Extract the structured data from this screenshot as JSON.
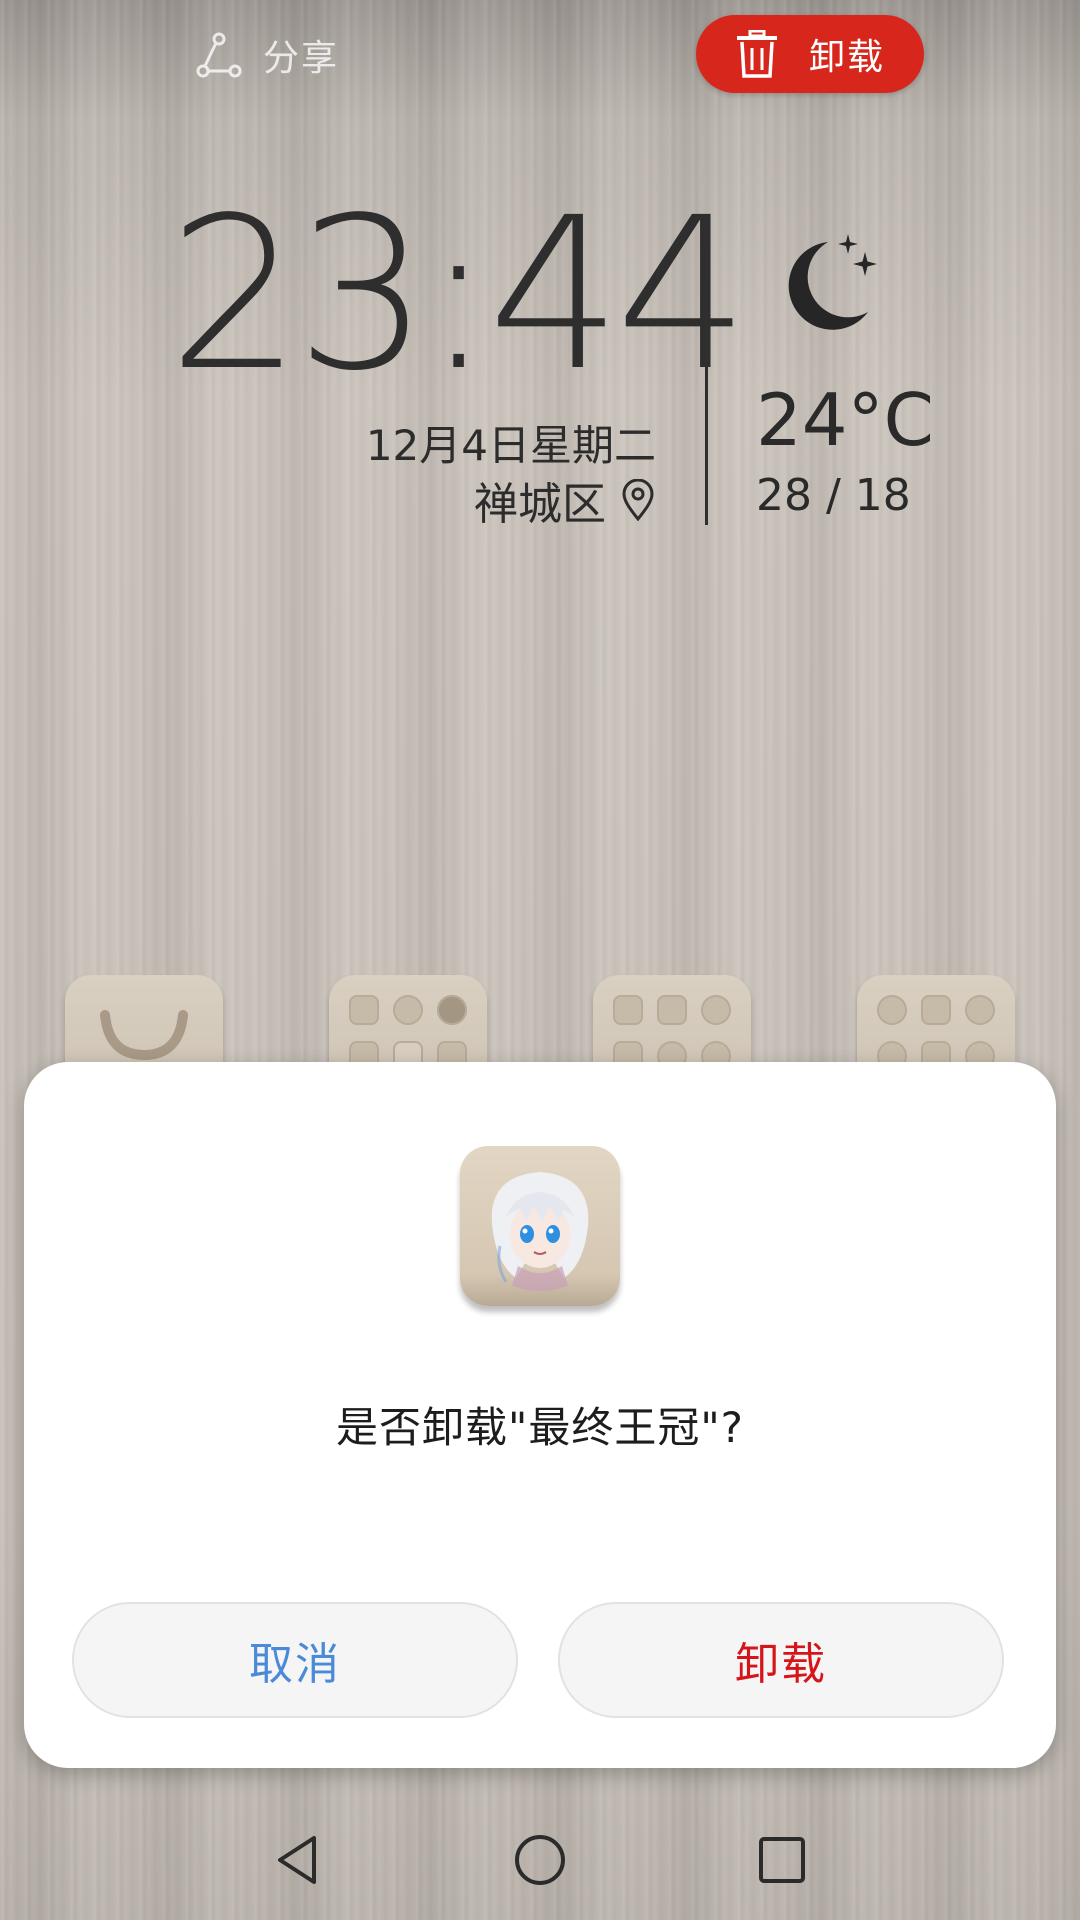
{
  "top_bar": {
    "share_label": "分享",
    "share_icon": "share-icon",
    "uninstall_label": "卸载",
    "uninstall_icon": "trash-icon",
    "uninstall_color": "#d7271d"
  },
  "clock_widget": {
    "time": "23:44",
    "date": "12月4日星期二",
    "location": "禅城区",
    "location_icon": "location-pin-icon"
  },
  "weather_widget": {
    "icon": "moon-stars-icon",
    "temperature": "24°C",
    "range": "28 / 18"
  },
  "dialog": {
    "app_icon": "anime-girl-app-icon",
    "question": "是否卸载\"最终王冠\"?",
    "cancel_label": "取消",
    "confirm_label": "卸载",
    "cancel_color": "#4a8ad6",
    "confirm_color": "#d6151b"
  },
  "navbar": {
    "back_icon": "back-triangle-icon",
    "home_icon": "home-circle-icon",
    "recent_icon": "recent-square-icon"
  }
}
